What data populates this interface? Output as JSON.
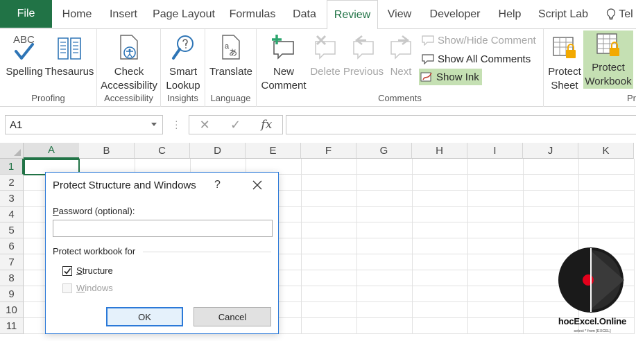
{
  "tabs": {
    "file": "File",
    "home": "Home",
    "insert": "Insert",
    "page_layout": "Page Layout",
    "formulas": "Formulas",
    "data": "Data",
    "review": "Review",
    "view": "View",
    "developer": "Developer",
    "help": "Help",
    "script_lab": "Script Lab",
    "tell_me": "Tel"
  },
  "ribbon": {
    "proofing": {
      "label": "Proofing",
      "spelling": "Spelling",
      "thesaurus": "Thesaurus",
      "abc": "ABC"
    },
    "accessibility": {
      "label": "Accessibility",
      "check_line1": "Check",
      "check_line2": "Accessibility"
    },
    "insights": {
      "label": "Insights",
      "smart_line1": "Smart",
      "smart_line2": "Lookup"
    },
    "language": {
      "label": "Language",
      "translate": "Translate"
    },
    "comments": {
      "label": "Comments",
      "new_line1": "New",
      "new_line2": "Comment",
      "delete": "Delete",
      "previous": "Previous",
      "next": "Next",
      "show_hide": "Show/Hide Comment",
      "show_all": "Show All Comments",
      "show_ink": "Show Ink"
    },
    "protect": {
      "label": "Pr",
      "sheet_line1": "Protect",
      "sheet_line2": "Sheet",
      "workbook_line1": "Protect",
      "workbook_line2": "Workbook"
    }
  },
  "formula_bar": {
    "name_box": "A1",
    "fx": "fx",
    "formula": ""
  },
  "grid": {
    "columns": [
      "A",
      "B",
      "C",
      "D",
      "E",
      "F",
      "G",
      "H",
      "I",
      "J",
      "K"
    ],
    "rows": [
      "1",
      "2",
      "3",
      "4",
      "5",
      "6",
      "7",
      "8",
      "9",
      "10",
      "11"
    ],
    "active_cell": "A1"
  },
  "dialog": {
    "title": "Protect Structure and Windows",
    "help": "?",
    "password_label_u": "P",
    "password_label_rest": "assword (optional):",
    "password_value": "",
    "section_label": "Protect workbook for",
    "structure_u": "S",
    "structure_rest": "tructure",
    "structure_checked": true,
    "windows_u": "W",
    "windows_rest": "indows",
    "windows_checked": false,
    "ok": "OK",
    "cancel": "Cancel"
  },
  "logo": {
    "name": "hocExcel.Online",
    "tagline": "select * from [EXCEL]"
  },
  "colors": {
    "excel_green": "#217346",
    "selected_highlight": "#c5e0b3",
    "dialog_border": "#2b79d8",
    "logo_red": "#e3001b"
  }
}
